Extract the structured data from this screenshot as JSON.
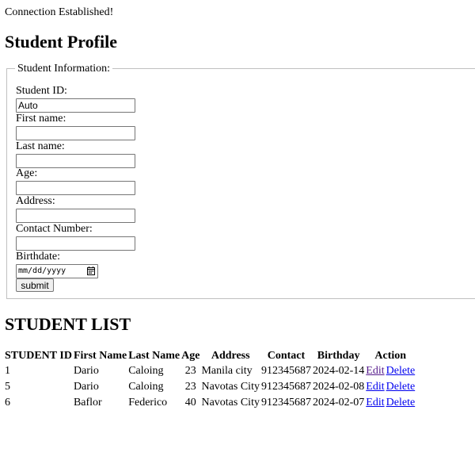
{
  "status": "Connection Established!",
  "page_title": "Student Profile",
  "form": {
    "legend": "Student Information:",
    "fields": [
      {
        "label": "Student ID:",
        "value": "Auto"
      },
      {
        "label": "First name:",
        "value": ""
      },
      {
        "label": "Last name:",
        "value": ""
      },
      {
        "label": "Age:",
        "value": ""
      },
      {
        "label": "Address:",
        "value": ""
      },
      {
        "label": "Contact Number:",
        "value": ""
      }
    ],
    "birthdate_label": "Birthdate:",
    "birthdate_placeholder": "mm/dd/yyyy",
    "submit_label": "submit"
  },
  "list_title": "STUDENT LIST",
  "table": {
    "headers": [
      "STUDENT ID",
      "First Name",
      "Last Name",
      "Age",
      "Address",
      "Contact",
      "Birthday",
      "Action"
    ],
    "rows": [
      {
        "id": "1",
        "first": "Dario",
        "last": "Caloing",
        "age": "23",
        "address": "Manila city",
        "contact": "912345687",
        "birthday": "2024-02-14",
        "edit": "Edit",
        "delete": "Delete"
      },
      {
        "id": "5",
        "first": "Dario",
        "last": "Caloing",
        "age": "23",
        "address": "Navotas City",
        "contact": "912345687",
        "birthday": "2024-02-08",
        "edit": "Edit",
        "delete": "Delete"
      },
      {
        "id": "6",
        "first": "Baflor",
        "last": "Federico",
        "age": "40",
        "address": "Navotas City",
        "contact": "912345687",
        "birthday": "2024-02-07",
        "edit": "Edit",
        "delete": "Delete"
      }
    ]
  },
  "colors": {
    "link": "#0000ee",
    "visited_link": "#551a8b"
  }
}
